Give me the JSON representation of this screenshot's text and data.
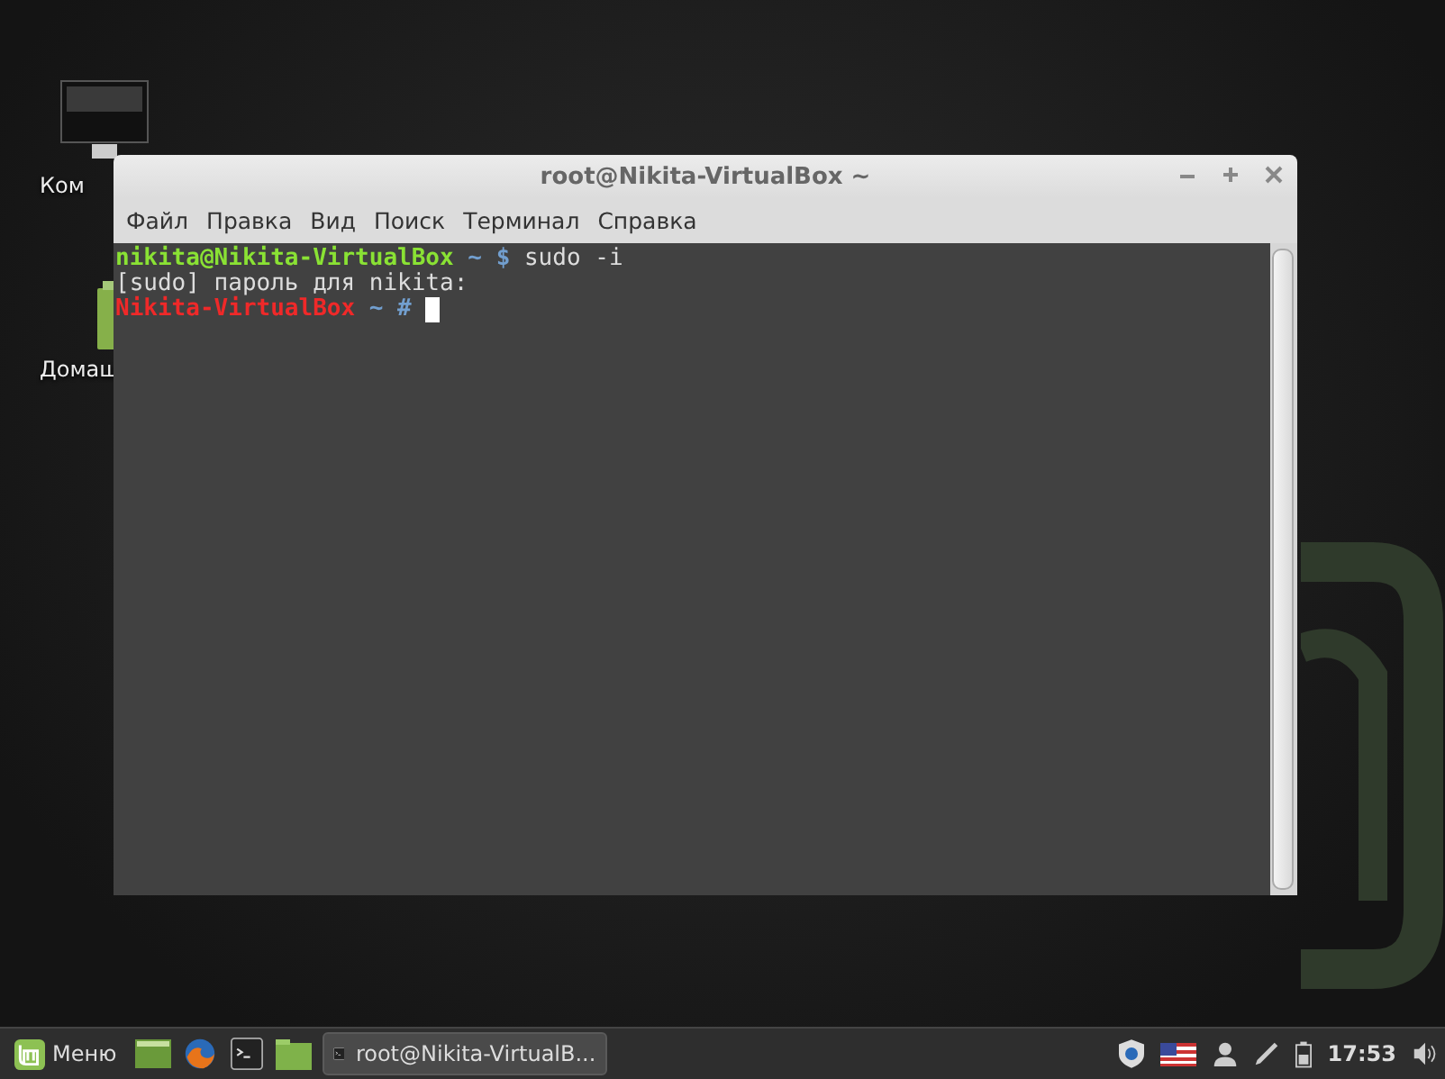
{
  "desktop": {
    "icons": [
      {
        "kind": "computer",
        "label": "Ком"
      },
      {
        "kind": "home",
        "label": "Домаш"
      }
    ]
  },
  "window": {
    "title": "root@Nikita-VirtualBox ~",
    "menu": [
      "Файл",
      "Правка",
      "Вид",
      "Поиск",
      "Терминал",
      "Справка"
    ],
    "lines": [
      {
        "kind": "user_prompt",
        "prompt": "nikita@Nikita-VirtualBox",
        "path": "~",
        "symbol": "$",
        "command": "sudo -i"
      },
      {
        "kind": "output",
        "text": "[sudo] пароль для nikita:"
      },
      {
        "kind": "root_prompt",
        "prompt": "Nikita-VirtualBox",
        "path": "~",
        "symbol": "#",
        "cursor": true
      }
    ]
  },
  "taskbar": {
    "menu_label": "Меню",
    "launchers": [
      {
        "kind": "desktop"
      },
      {
        "kind": "browser"
      },
      {
        "kind": "terminal"
      },
      {
        "kind": "folder"
      }
    ],
    "window_button": {
      "label": "root@Nikita-VirtualB...",
      "selected": true
    },
    "clock": "17:53"
  }
}
